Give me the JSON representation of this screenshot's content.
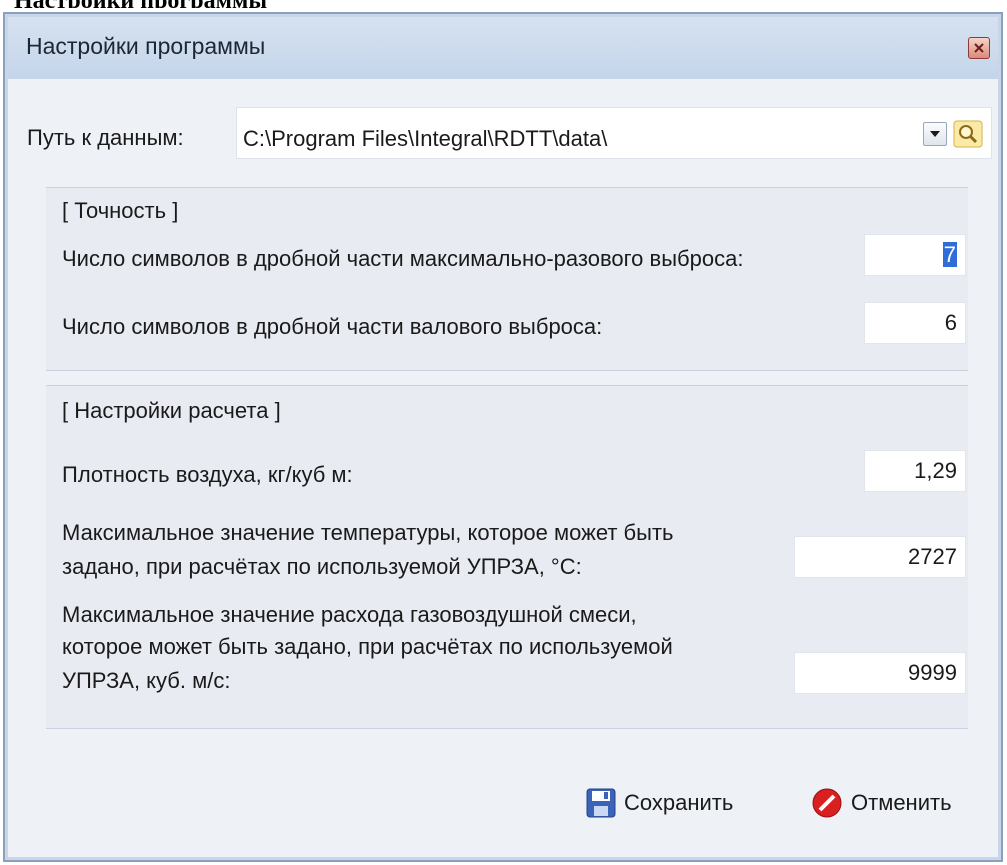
{
  "page_heading": "Настройки программы",
  "window": {
    "title": "Настройки программы"
  },
  "path": {
    "label": "Путь к данным:",
    "value": "C:\\Program Files\\Integral\\RDTT\\data\\"
  },
  "precision": {
    "title": "[ Точность ]",
    "max_emission_label": "Число символов в дробной части максимально-разового выброса:",
    "max_emission_value": "7",
    "gross_emission_label": "Число символов в дробной части валового выброса:",
    "gross_emission_value": "6"
  },
  "calc": {
    "title": "[ Настройки расчета ]",
    "air_density_label": "Плотность воздуха,  кг/куб м:",
    "air_density_value": "1,29",
    "max_temp_label_1": "Максимальное значение температуры, которое может быть",
    "max_temp_label_2": "задано, при расчётах по используемой УПРЗА, °C:",
    "max_temp_value": "2727",
    "max_flow_label_1": "Максимальное значение расхода газовоздушной смеси,",
    "max_flow_label_2": "которое может быть задано, при расчётах по используемой",
    "max_flow_label_3": "УПРЗА, куб. м/с:",
    "max_flow_value": "9999"
  },
  "buttons": {
    "save": "Сохранить",
    "cancel": "Отменить"
  },
  "colors": {
    "selection": "#2f6ed8",
    "cancel_icon": "#d91f1f",
    "save_icon": "#3b63b7"
  }
}
